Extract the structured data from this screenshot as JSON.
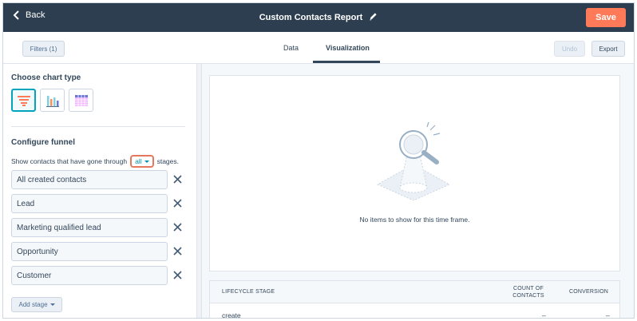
{
  "header": {
    "back_label": "Back",
    "report_title": "Custom Contacts Report",
    "save_label": "Save"
  },
  "toolbar": {
    "filters_label": "Filters (1)",
    "tabs": [
      {
        "label": "Data",
        "active": false
      },
      {
        "label": "Visualization",
        "active": true
      }
    ],
    "undo_label": "Undo",
    "export_label": "Export"
  },
  "left_panel": {
    "chart_type_title": "Choose chart type",
    "chart_types": [
      {
        "icon": "funnel-chart-icon",
        "selected": true
      },
      {
        "icon": "bar-chart-icon",
        "selected": false
      },
      {
        "icon": "table-chart-icon",
        "selected": false
      }
    ],
    "funnel_title": "Configure funnel",
    "stages_prefix": "Show contacts that have gone through",
    "stages_selector": "all",
    "stages_suffix": "stages.",
    "stages": [
      {
        "label": "All created contacts"
      },
      {
        "label": "Lead"
      },
      {
        "label": "Marketing qualified lead"
      },
      {
        "label": "Opportunity"
      },
      {
        "label": "Customer"
      }
    ],
    "add_stage_label": "Add stage"
  },
  "visualization": {
    "empty_message": "No items to show for this time frame."
  },
  "table": {
    "headers": {
      "stage": "LIFECYCLE STAGE",
      "count_line1": "COUNT OF",
      "count_line2": "CONTACTS",
      "conversion": "CONVERSION"
    },
    "rows": [
      {
        "stage": "create",
        "count": "–",
        "conversion": "–"
      }
    ]
  },
  "colors": {
    "header_bg": "#2d3e50",
    "accent_orange": "#ff7a59",
    "selected_teal": "#00a4bd",
    "highlight_ring": "#e5775d"
  }
}
